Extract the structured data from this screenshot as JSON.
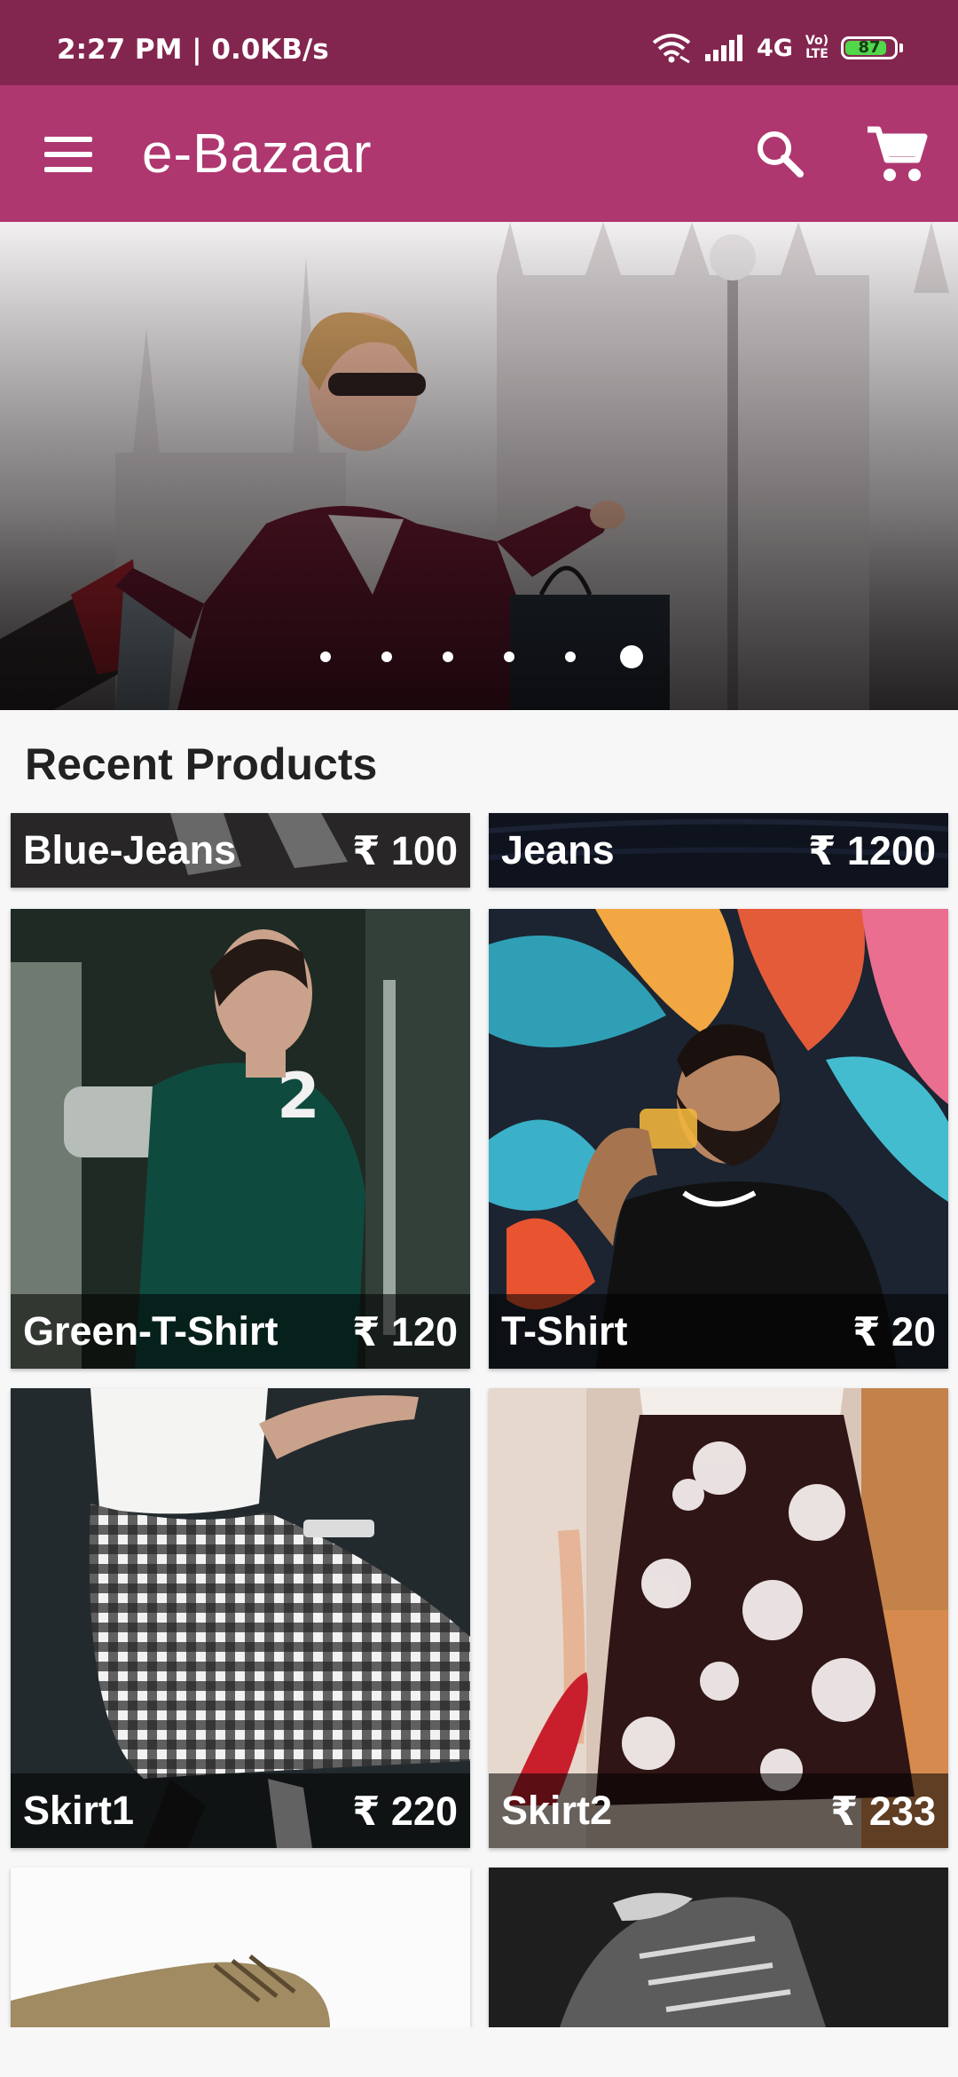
{
  "status_bar": {
    "time": "2:27 PM | 0.0KB/s",
    "network": "4G",
    "volte_line1": "Vo)",
    "volte_line2": "LTE",
    "battery": "87",
    "battery_level": 0.87,
    "icons": [
      "wifi-icon",
      "signal-icon",
      "volte-icon",
      "battery-icon"
    ]
  },
  "app_bar": {
    "title": "e-Bazaar",
    "color": "#ae3770",
    "icons": [
      "menu-icon",
      "search-icon",
      "cart-icon"
    ]
  },
  "banner": {
    "slide_count": 6,
    "active_slide": 6
  },
  "section": {
    "title": "Recent Products"
  },
  "products": [
    {
      "name": "Blue-Jeans",
      "price": "₹ 100"
    },
    {
      "name": "Jeans",
      "price": "₹ 1200"
    },
    {
      "name": "Green-T-Shirt",
      "price": "₹ 120"
    },
    {
      "name": "T-Shirt",
      "price": "₹ 20"
    },
    {
      "name": "Skirt1",
      "price": "₹ 220"
    },
    {
      "name": "Skirt2",
      "price": "₹ 233"
    }
  ],
  "colors": {
    "status_bar": "#83264f",
    "app_bar": "#ae3770",
    "battery_fill": "#52d64a"
  }
}
